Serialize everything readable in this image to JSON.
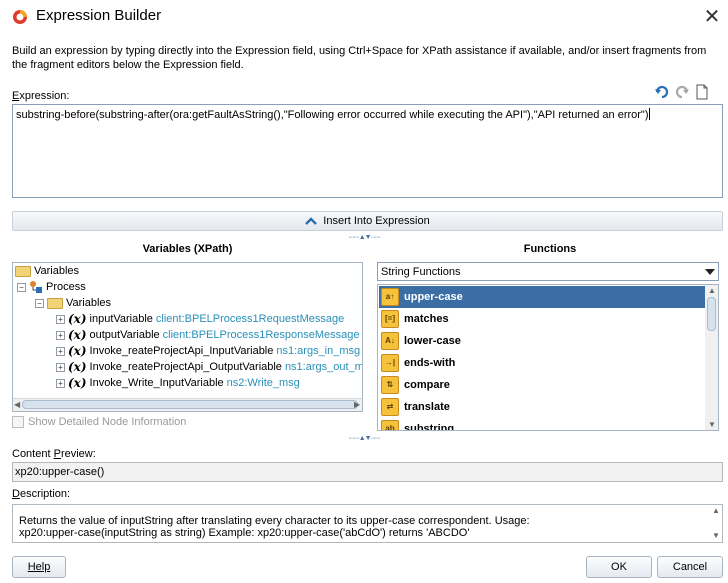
{
  "window": {
    "title": "Expression Builder",
    "close_glyph": "✕"
  },
  "intro": "Build an expression by typing directly into the Expression field, using Ctrl+Space for XPath assistance if available, and/or insert fragments from the fragment editors below the Expression field.",
  "expression": {
    "label_first": "E",
    "label_rest": "xpression:",
    "value": "substring-before(substring-after(ora:getFaultAsString(),\"Following error occurred while executing the API\"),\"API returned an error\")",
    "tools": [
      "undo-icon",
      "redo-icon",
      "clear-icon"
    ]
  },
  "insert_button": "Insert Into Expression",
  "variables": {
    "header": "Variables (XPath)",
    "tree": [
      {
        "label": "Variables",
        "ns": ""
      },
      {
        "label": "Process",
        "ns": ""
      },
      {
        "label": "Variables",
        "ns": ""
      },
      {
        "label": "inputVariable",
        "ns": "client:BPELProcess1RequestMessage"
      },
      {
        "label": "outputVariable",
        "ns": "client:BPELProcess1ResponseMessage"
      },
      {
        "label": "Invoke_reateProjectApi_InputVariable",
        "ns": "ns1:args_in_msg"
      },
      {
        "label": "Invoke_reateProjectApi_OutputVariable",
        "ns": "ns1:args_out_msg"
      },
      {
        "label": "Invoke_Write_InputVariable",
        "ns": "ns2:Write_msg"
      }
    ],
    "show_detail": "Show Detailed Node Information"
  },
  "functions": {
    "header": "Functions",
    "category": "String Functions",
    "items": [
      "upper-case",
      "matches",
      "lower-case",
      "ends-with",
      "compare",
      "translate",
      "substring"
    ],
    "selected": "upper-case"
  },
  "content_preview": {
    "label_pre": "Content ",
    "label_u": "P",
    "label_post": "review:",
    "value": "xp20:upper-case()"
  },
  "description": {
    "label_first": "D",
    "label_rest": "escription:",
    "line1": "Returns the value of inputString after translating every character to its upper-case correspondent. Usage:",
    "line2": "xp20:upper-case(inputString as string) Example: xp20:upper-case('abCdO') returns 'ABCDO'"
  },
  "buttons": {
    "help": "Help",
    "ok": "OK",
    "cancel": "Cancel"
  },
  "colors": {
    "selection": "#3a6ea5",
    "namespace": "#2a8fb8",
    "accent": "#4a6fa5"
  }
}
